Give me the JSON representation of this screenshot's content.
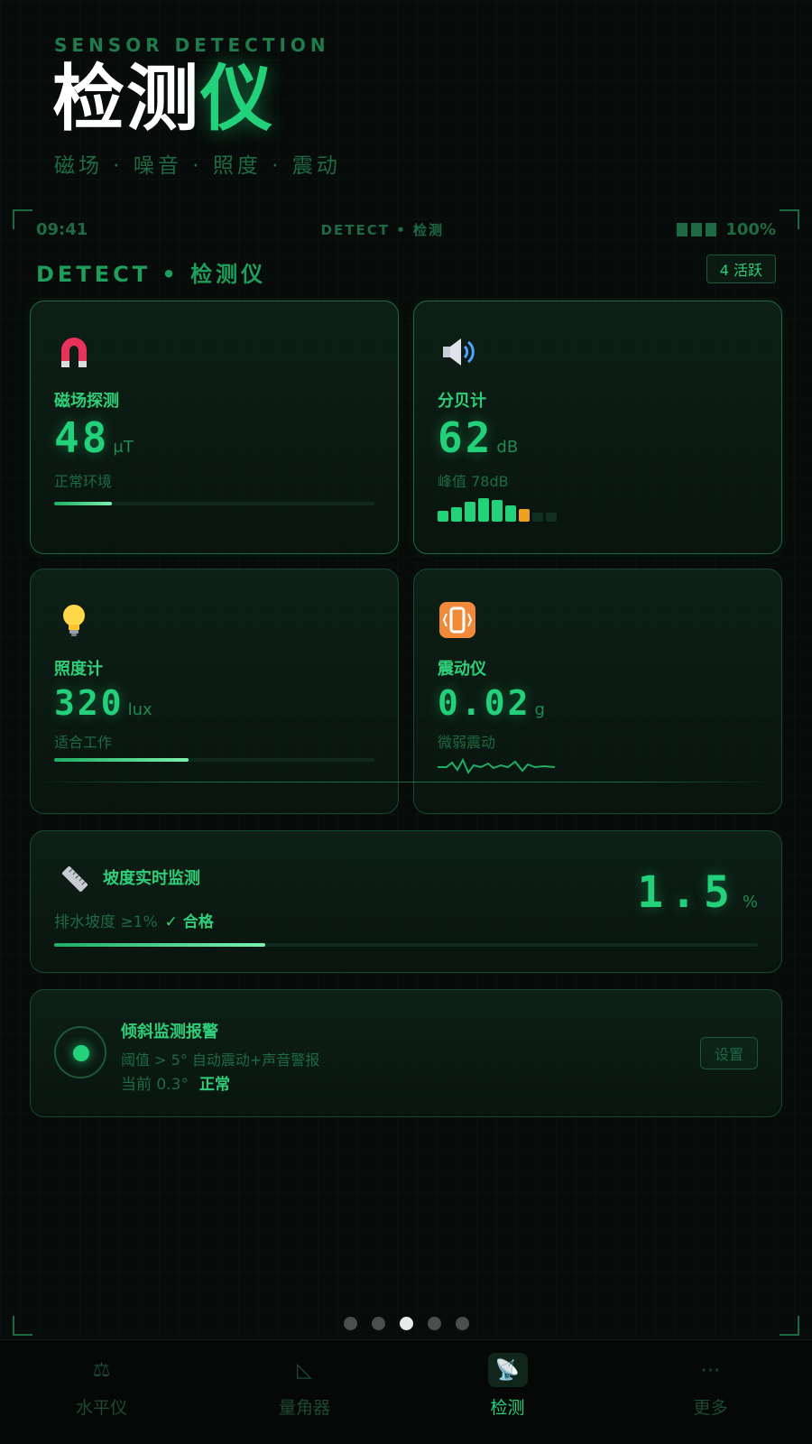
{
  "hero": {
    "eyebrow": "SENSOR DETECTION",
    "title_white": "检测",
    "title_green": "仪",
    "subtitle": "磁场 · 噪音 · 照度 · 震动"
  },
  "status": {
    "time": "09:41",
    "center": "DETECT • 检测",
    "battery": "100%"
  },
  "section": {
    "title": "DETECT • 检测仪",
    "badge": "4 活跃"
  },
  "cards": {
    "magnet": {
      "icon": "magnet-icon",
      "title": "磁场探测",
      "value": "48",
      "unit": "μT",
      "desc": "正常环境",
      "level": 0.18
    },
    "decibel": {
      "icon": "speaker-icon",
      "title": "分贝计",
      "value": "62",
      "unit": "dB",
      "desc": "峰值 78dB",
      "bars_lit": 7,
      "bars_warn": 1,
      "bars_total": 9
    },
    "lux": {
      "icon": "lightbulb-icon",
      "title": "照度计",
      "value": "320",
      "unit": "lux",
      "desc": "适合工作",
      "level": 0.42
    },
    "vibration": {
      "icon": "vibration-icon",
      "title": "震动仪",
      "value": "0.02",
      "unit": "g",
      "desc": "微弱震动"
    }
  },
  "slope": {
    "icon": "ruler-icon",
    "title": "坡度实时监测",
    "desc": "排水坡度 ≥1%",
    "status": "✓ 合格",
    "value": "1.5",
    "unit": "%",
    "level": 0.3
  },
  "alarm": {
    "title": "倾斜监测报警",
    "line1": "阈值 > 5° 自动震动+声音警报",
    "current": "当前 0.3°",
    "status": "正常",
    "button": "设置"
  },
  "pager": {
    "count": 5,
    "active": 2
  },
  "tabs": [
    {
      "label": "水平仪",
      "icon": "level-icon",
      "active": false
    },
    {
      "label": "量角器",
      "icon": "protractor-icon",
      "active": false
    },
    {
      "label": "检测",
      "icon": "detect-icon",
      "active": true
    },
    {
      "label": "更多",
      "icon": "more-icon",
      "active": false
    }
  ],
  "colors": {
    "accent": "#22d17a",
    "warn": "#f0a020",
    "background": "#070b09"
  }
}
